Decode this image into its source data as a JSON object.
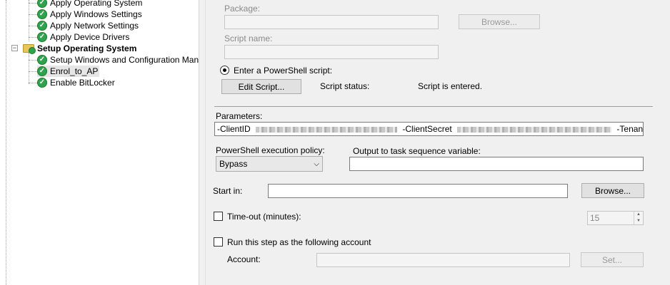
{
  "tree": {
    "items": [
      {
        "label": "Apply Operating System",
        "icon": "check-icon"
      },
      {
        "label": "Apply Windows Settings",
        "icon": "check-icon"
      },
      {
        "label": "Apply Network Settings",
        "icon": "check-icon"
      },
      {
        "label": "Apply Device Drivers",
        "icon": "check-icon"
      },
      {
        "label": "Setup Operating System",
        "icon": "folder-icon",
        "group": true
      },
      {
        "label": "Setup Windows and Configuration Manager",
        "icon": "check-icon"
      },
      {
        "label": "Enrol_to_AP",
        "icon": "check-icon"
      },
      {
        "label": "Enable BitLocker",
        "icon": "check-icon"
      }
    ],
    "expander_symbol": "−"
  },
  "form": {
    "package_label": "Package:",
    "package_value": "",
    "browse_package_label": "Browse...",
    "script_name_label": "Script name:",
    "script_name_value": "",
    "enter_script_label": "Enter a PowerShell script:",
    "edit_script_label": "Edit Script...",
    "script_status_label": "Script status:",
    "script_status_value": "Script is entered.",
    "parameters_label": "Parameters:",
    "param_clientid": "-ClientID",
    "param_clientsecret": "-ClientSecret",
    "param_tenantid": "-TenantId",
    "policy_label": "PowerShell execution policy:",
    "policy_value": "Bypass",
    "output_var_label": "Output to task sequence variable:",
    "output_var_value": "",
    "start_in_label": "Start in:",
    "start_in_value": "",
    "browse_start_label": "Browse...",
    "timeout_label": "Time-out (minutes):",
    "timeout_value": "15",
    "run_as_label": "Run this step as the following account",
    "account_label": "Account:",
    "account_value": "",
    "set_label": "Set..."
  }
}
